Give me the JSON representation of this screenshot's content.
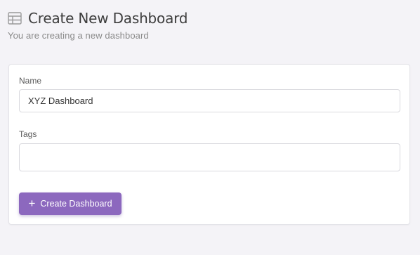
{
  "header": {
    "icon": "table-icon",
    "title": "Create New Dashboard",
    "subtitle": "You are creating a new dashboard"
  },
  "form": {
    "name": {
      "label": "Name",
      "value": "XYZ Dashboard"
    },
    "tags": {
      "label": "Tags",
      "value": ""
    },
    "submit": {
      "icon": "plus-icon",
      "label": "Create Dashboard"
    }
  },
  "colors": {
    "accent": "#8c68be",
    "background": "#f4f3f7",
    "card": "#ffffff"
  }
}
